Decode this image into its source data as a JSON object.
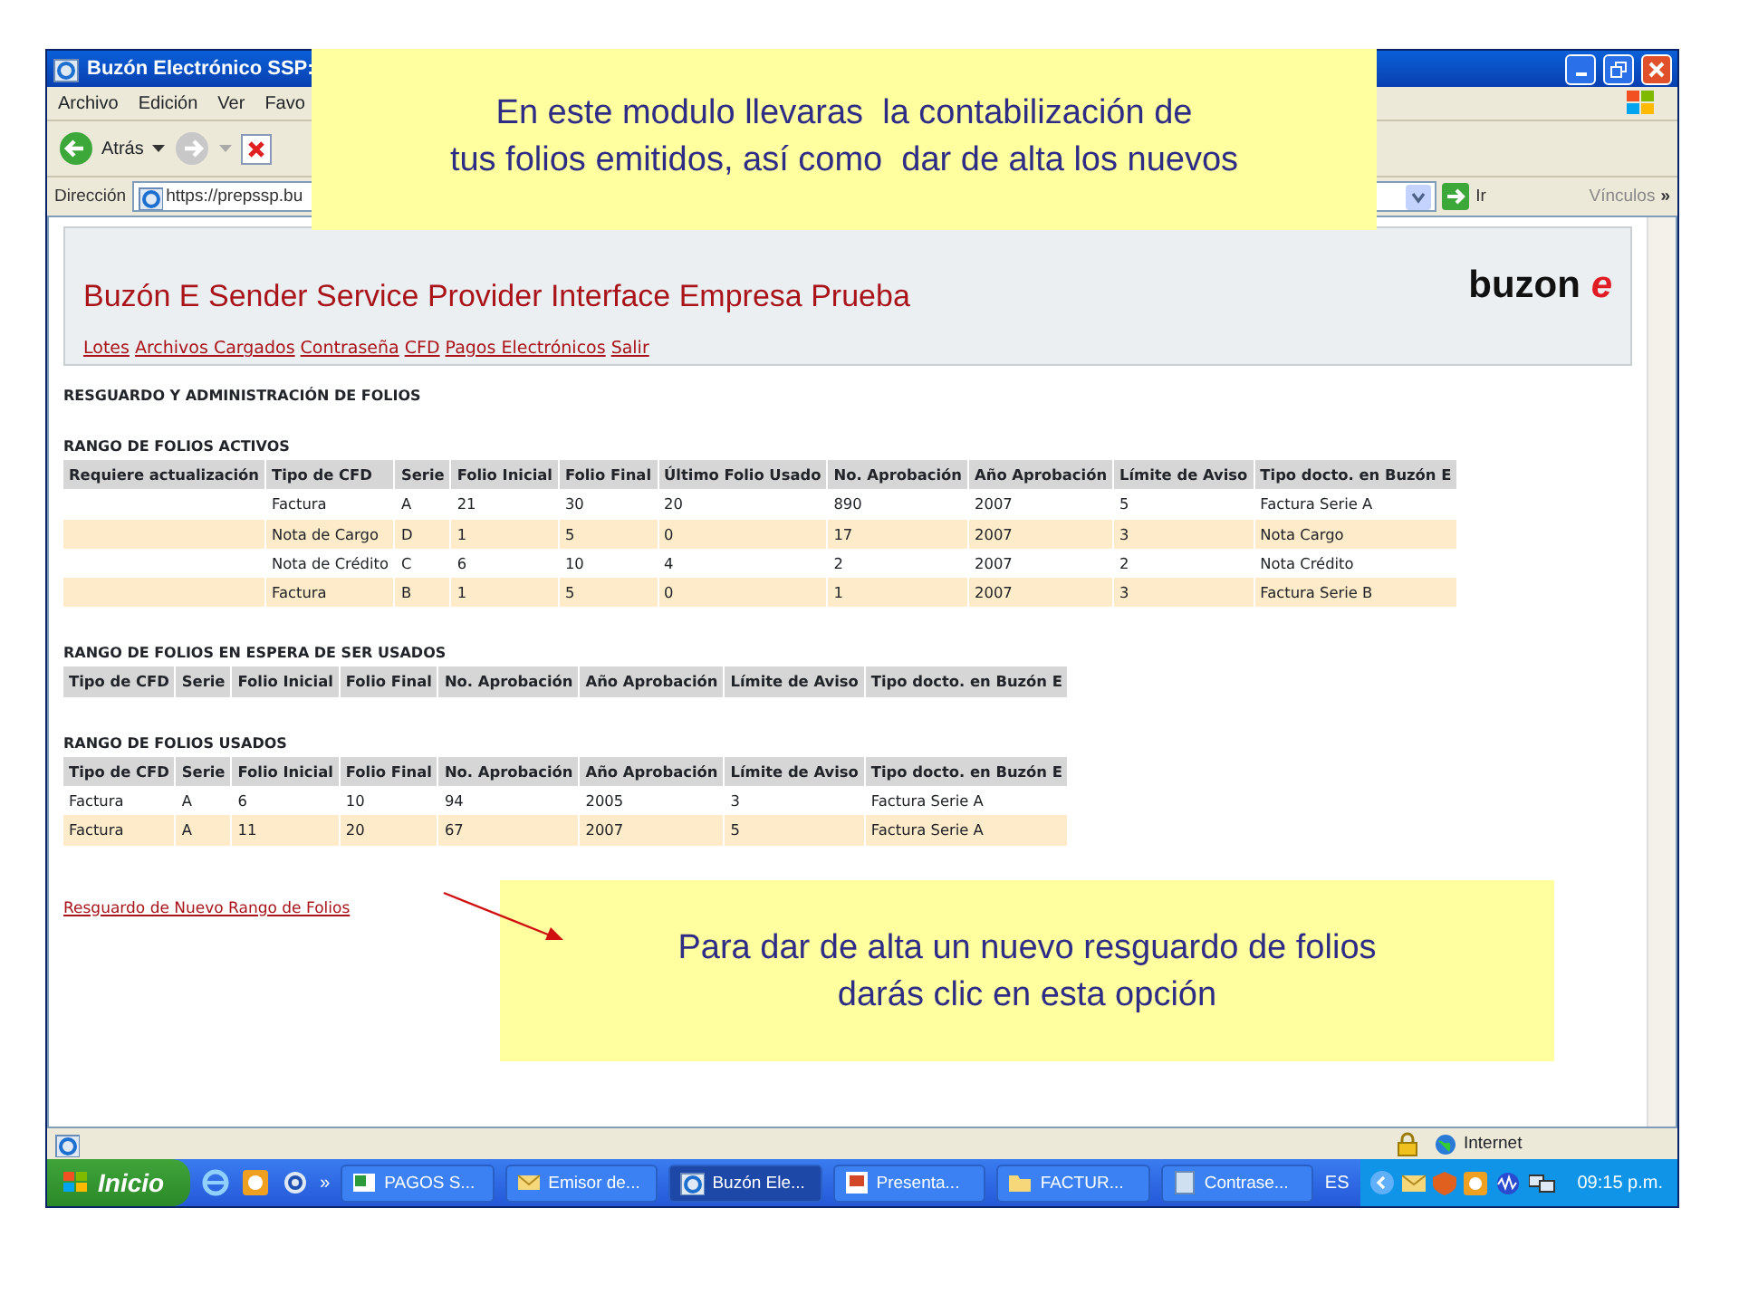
{
  "window": {
    "title": "Buzón Electrónico SSP:",
    "menu": [
      "Archivo",
      "Edición",
      "Ver",
      "Favo"
    ],
    "toolbar": {
      "back": "Atrás"
    },
    "address": {
      "label": "Dirección",
      "value": "https://prepssp.bu",
      "go": "Ir",
      "links": "Vínculos",
      "more": "»"
    }
  },
  "page": {
    "header": {
      "title": "Buzón E Sender Service Provider Interface Empresa Prueba",
      "logo": {
        "text": "buzon",
        "accent": "e"
      },
      "nav": [
        "Lotes",
        "Archivos Cargados",
        "Contraseña",
        "CFD",
        "Pagos Electrónicos",
        "Salir"
      ]
    },
    "heading": "RESGUARDO Y ADMINISTRACIÓN DE FOLIOS",
    "sections": [
      {
        "title": "RANGO DE FOLIOS ACTIVOS",
        "columns": [
          "Requiere actualización",
          "Tipo de CFD",
          "Serie",
          "Folio Inicial",
          "Folio Final",
          "Último Folio Usado",
          "No. Aprobación",
          "Año Aprobación",
          "Límite de Aviso",
          "Tipo docto. en Buzón E"
        ],
        "rows": [
          [
            "",
            "Factura",
            "A",
            "21",
            "30",
            "20",
            "890",
            "2007",
            "5",
            "Factura Serie A"
          ],
          [
            "",
            "Nota de Cargo",
            "D",
            "1",
            "5",
            "0",
            "17",
            "2007",
            "3",
            "Nota Cargo"
          ],
          [
            "",
            "Nota de Crédito",
            "C",
            "6",
            "10",
            "4",
            "2",
            "2007",
            "2",
            "Nota Crédito"
          ],
          [
            "",
            "Factura",
            "B",
            "1",
            "5",
            "0",
            "1",
            "2007",
            "3",
            "Factura Serie B"
          ]
        ]
      },
      {
        "title": "RANGO DE FOLIOS EN ESPERA DE SER USADOS",
        "columns": [
          "Tipo de CFD",
          "Serie",
          "Folio Inicial",
          "Folio Final",
          "No. Aprobación",
          "Año Aprobación",
          "Límite de Aviso",
          "Tipo docto. en Buzón E"
        ]
      },
      {
        "title": "RANGO DE FOLIOS USADOS",
        "columns": [
          "Tipo de CFD",
          "Serie",
          "Folio Inicial",
          "Folio Final",
          "No. Aprobación",
          "Año Aprobación",
          "Límite de Aviso",
          "Tipo docto. en Buzón E"
        ],
        "rows": [
          [
            "Factura",
            "A",
            "6",
            "10",
            "94",
            "2005",
            "3",
            "Factura Serie A"
          ],
          [
            "Factura",
            "A",
            "11",
            "20",
            "67",
            "2007",
            "5",
            "Factura Serie A"
          ]
        ]
      }
    ],
    "link": "Resguardo de Nuevo Rango de Folios"
  },
  "status_bar": {
    "zone": "Internet"
  },
  "taskbar": {
    "start": "Inicio",
    "chevron": "»",
    "tasks": [
      {
        "label": "PAGOS S...",
        "selected": false
      },
      {
        "label": "Emisor de...",
        "selected": false
      },
      {
        "label": "Buzón Ele...",
        "selected": true
      },
      {
        "label": "Presenta...",
        "selected": false
      },
      {
        "label": "FACTUR...",
        "selected": false
      },
      {
        "label": "Contrase...",
        "selected": false
      }
    ],
    "language": "ES",
    "time": "09:15 p.m."
  },
  "callouts": [
    {
      "lines": [
        "En este modulo llevaras  la contabilización de",
        "tus folios emitidos, así como  dar de alta los nuevos"
      ]
    },
    {
      "lines": [
        "Para dar de alta un nuevo resguardo de folios",
        "darás clic en esta opción"
      ]
    }
  ]
}
